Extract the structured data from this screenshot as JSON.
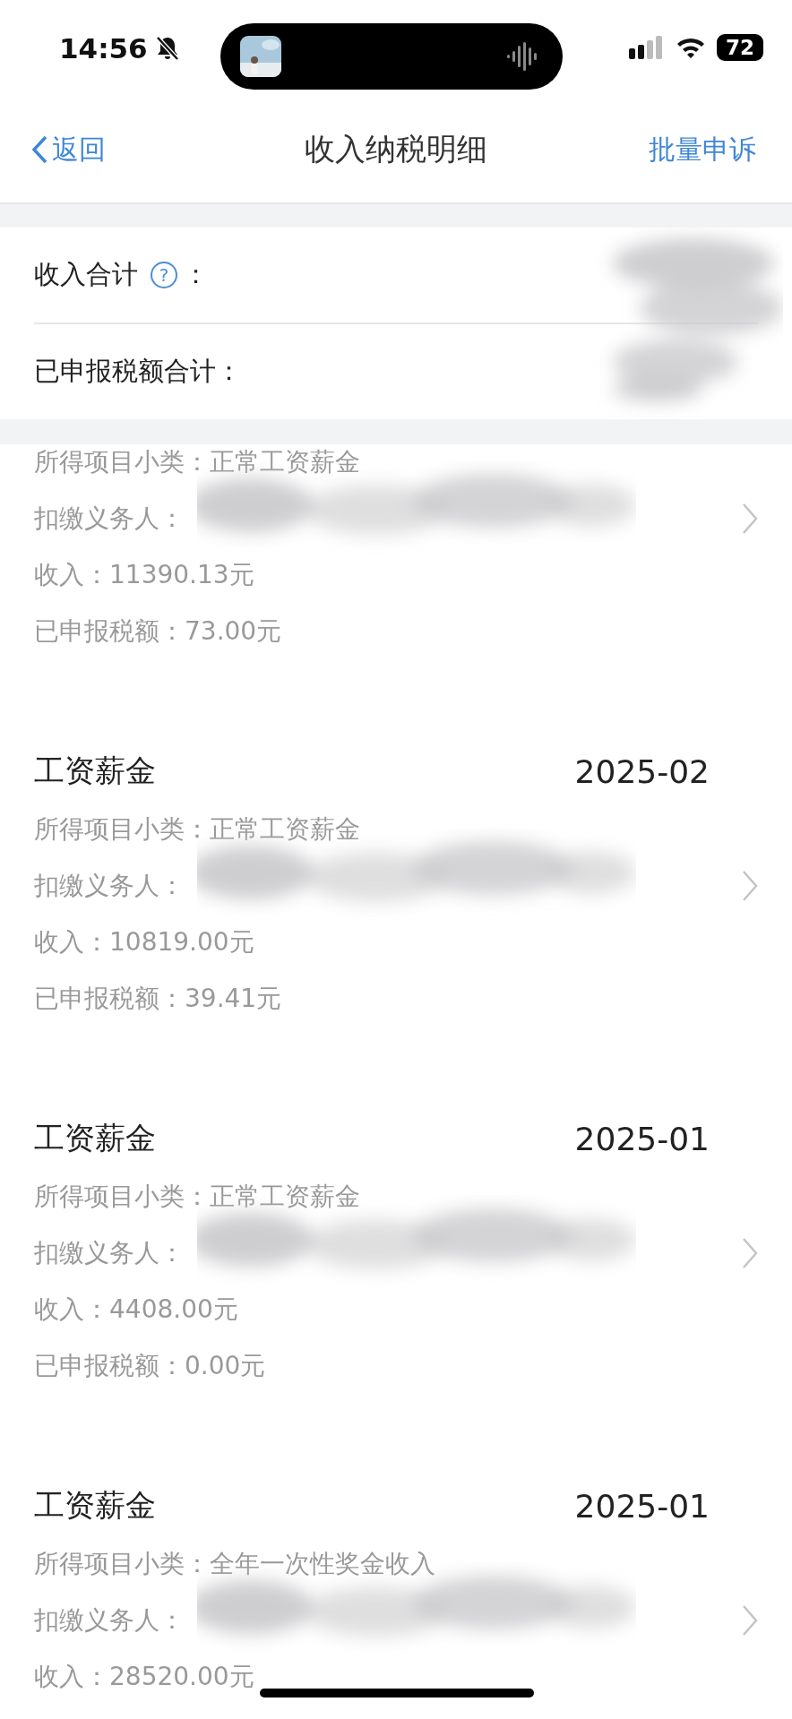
{
  "status_bar": {
    "time": "14:56",
    "battery": "72"
  },
  "nav": {
    "back": "返回",
    "title": "收入纳税明细",
    "action": "批量申诉"
  },
  "summary": {
    "rows": [
      {
        "label": "收入合计",
        "help": "?",
        "suffix": "："
      },
      {
        "label": "已申报税额合计：",
        "suffix": ""
      }
    ]
  },
  "records": [
    {
      "lines": [
        "所得项目小类：正常工资薪金",
        "扣缴义务人：",
        "收入：11390.13元",
        "已申报税额：73.00元"
      ]
    },
    {
      "title": "工资薪金",
      "date": "2025-02",
      "lines": [
        "所得项目小类：正常工资薪金",
        "扣缴义务人：",
        "收入：10819.00元",
        "已申报税额：39.41元"
      ]
    },
    {
      "title": "工资薪金",
      "date": "2025-01",
      "lines": [
        "所得项目小类：正常工资薪金",
        "扣缴义务人：",
        "收入：4408.00元",
        "已申报税额：0.00元"
      ]
    },
    {
      "title": "工资薪金",
      "date": "2025-01",
      "lines": [
        "所得项目小类：全年一次性奖金收入",
        "扣缴义务人：",
        "收入：28520.00元"
      ]
    }
  ]
}
